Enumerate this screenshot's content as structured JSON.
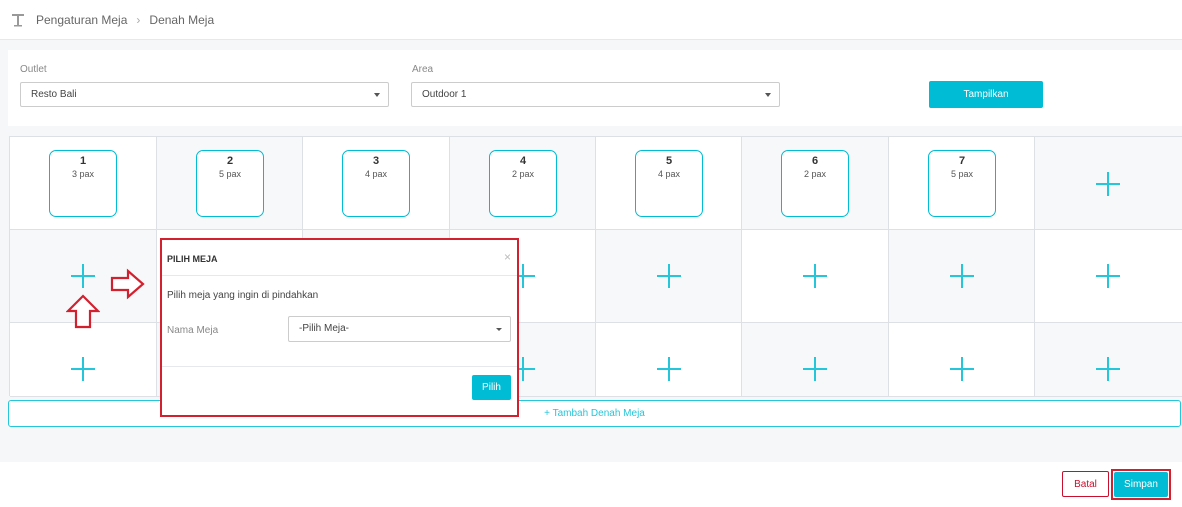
{
  "breadcrumb": {
    "items": [
      "Pengaturan Meja",
      "Denah Meja"
    ]
  },
  "filters": {
    "outlet_label": "Outlet",
    "outlet_value": "Resto Bali",
    "area_label": "Area",
    "area_value": "Outdoor 1",
    "show_button": "Tampilkan"
  },
  "tables": [
    {
      "number": "1",
      "pax": "3 pax"
    },
    {
      "number": "2",
      "pax": "5 pax"
    },
    {
      "number": "3",
      "pax": "4 pax"
    },
    {
      "number": "4",
      "pax": "2 pax"
    },
    {
      "number": "5",
      "pax": "4 pax"
    },
    {
      "number": "6",
      "pax": "2 pax"
    },
    {
      "number": "7",
      "pax": "5 pax"
    }
  ],
  "add_floor_plan": "+ Tambah Denah Meja",
  "modal": {
    "title": "PILIH MEJA",
    "close": "×",
    "instruction": "Pilih meja yang ingin di pindahkan",
    "field_label": "Nama Meja",
    "select_value": "-Pilih Meja-",
    "choose_button": "Pilih"
  },
  "footer": {
    "cancel": "Batal",
    "save": "Simpan"
  },
  "colors": {
    "accent": "#00bcd4",
    "highlight": "#d3202f",
    "plus": "#26c6da"
  },
  "icons": {
    "cell_add": "plus-icon",
    "annotation_right": "arrow-right-icon",
    "annotation_up": "arrow-up-icon"
  }
}
